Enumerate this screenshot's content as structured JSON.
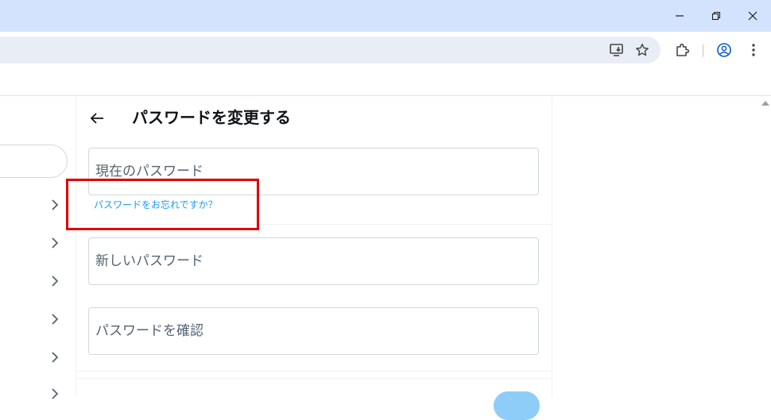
{
  "browser": {
    "window_controls": {
      "minimize_icon": "minimize-icon",
      "restore_icon": "restore-icon",
      "close_icon": "close-icon"
    },
    "toolbar_icons": [
      "install-app-icon",
      "bookmark-star-icon",
      "extensions-icon",
      "profile-icon",
      "menu-kebab-icon"
    ]
  },
  "page": {
    "title": "パスワードを変更する",
    "current_password": {
      "placeholder": "現在のパスワード",
      "value": ""
    },
    "forgot_link": "パスワードをお忘れですか？",
    "new_password": {
      "placeholder": "新しいパスワード",
      "value": ""
    },
    "confirm_password": {
      "placeholder": "パスワードを確認",
      "value": ""
    }
  },
  "colors": {
    "accent": "#1d9bf0",
    "highlight": "#e00000",
    "titlebar": "#d3e3fd",
    "omnibox": "#e9eef6"
  }
}
